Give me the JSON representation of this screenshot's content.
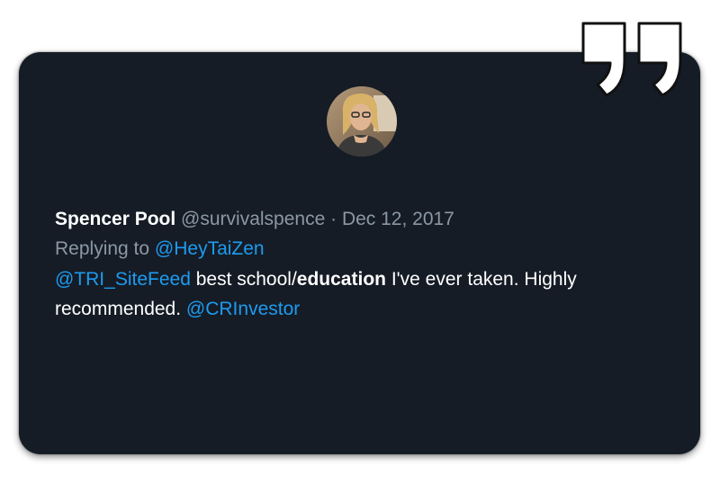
{
  "tweet": {
    "author_name": "Spencer Pool",
    "author_handle": "@survivalspence",
    "separator": " · ",
    "date": "Dec 12, 2017",
    "replying_prefix": "Replying to ",
    "replying_to": "@HeyTaiZen",
    "body": {
      "mention_1": "@TRI_SiteFeed",
      "text_1": " best school/",
      "text_bold": "education",
      "text_2": " I've ever taken. Highly recommended. ",
      "mention_2": "@CRInvestor"
    }
  },
  "icons": {
    "quote": "closing-quote-icon",
    "avatar": "avatar-photo"
  },
  "colors": {
    "card_background": "#151c26",
    "mention": "#1d9bf0",
    "muted": "#8b98a5",
    "text": "#ffffff"
  }
}
